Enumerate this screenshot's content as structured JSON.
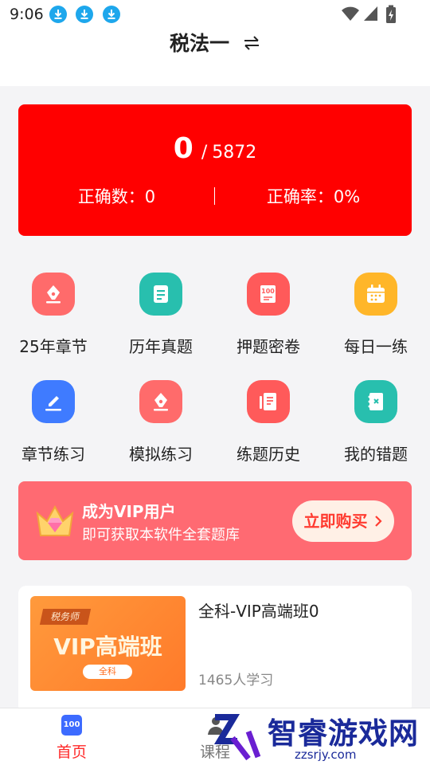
{
  "status_bar": {
    "time": "9:06"
  },
  "header": {
    "title": "税法一"
  },
  "score": {
    "correct_num": "0",
    "separator": "/",
    "total": "5872",
    "correct_count_label": "正确数：0",
    "accuracy_label": "正确率：0%"
  },
  "grid": [
    {
      "label": "25年章节",
      "icon": "pen-nib-icon",
      "color": "#ff6b6b"
    },
    {
      "label": "历年真题",
      "icon": "document-icon",
      "color": "#28bfae"
    },
    {
      "label": "押题密卷",
      "icon": "exam-paper-icon",
      "color": "#ff5a5a"
    },
    {
      "label": "每日一练",
      "icon": "calendar-icon",
      "color": "#ffb629"
    },
    {
      "label": "章节练习",
      "icon": "edit-icon",
      "color": "#3f7bff"
    },
    {
      "label": "模拟练习",
      "icon": "pen-nib-icon",
      "color": "#ff6b6b"
    },
    {
      "label": "练题历史",
      "icon": "history-notes-icon",
      "color": "#ff5a5a"
    },
    {
      "label": "我的错题",
      "icon": "wrong-notebook-icon",
      "color": "#28bfae"
    }
  ],
  "vip_banner": {
    "title": "成为VIP用户",
    "subtitle": "即可获取本软件全套题库",
    "button": "立即购买"
  },
  "course": {
    "thumb_tag": "税务师",
    "thumb_title": "VIP高端班",
    "thumb_pill": "全科",
    "title": "全科-VIP高端班0",
    "learners": "1465人学习"
  },
  "bottom_nav": {
    "home": "首页",
    "course": "课程"
  },
  "watermark": {
    "brand": "智睿游戏网",
    "url": "zzsrjy.com"
  }
}
